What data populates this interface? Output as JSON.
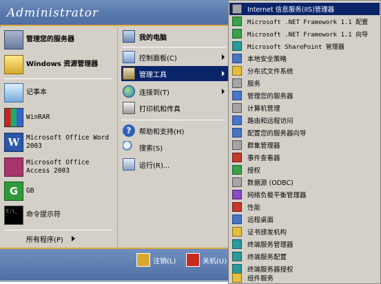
{
  "start_menu": {
    "user_name": "Administrator",
    "left_items": [
      {
        "label": "管理您的服务器",
        "icon": "server-manage-icon",
        "bold": true
      },
      {
        "label": "Windows 资源管理器",
        "icon": "explorer-icon",
        "bold": true
      },
      {
        "label": "记事本",
        "icon": "notepad-icon"
      },
      {
        "label": "WinRAR",
        "icon": "winrar-icon"
      },
      {
        "label": "Microsoft Office Word 2003",
        "icon": "word-icon"
      },
      {
        "label": "Microsoft Office Access 2003",
        "icon": "access-icon"
      },
      {
        "label": "GB",
        "icon": "gb-icon"
      },
      {
        "label": "命令提示符",
        "icon": "cmd-icon"
      }
    ],
    "all_programs": "所有程序(P)",
    "right_items": [
      {
        "label": "我的电脑",
        "icon": "computer-icon",
        "bold": true
      },
      {
        "label": "控制面板(C)",
        "icon": "control-panel-icon",
        "submenu": true
      },
      {
        "label": "管理工具",
        "icon": "admin-tools-icon",
        "submenu": true,
        "active": true
      },
      {
        "label": "连接到(T)",
        "icon": "connect-icon",
        "submenu": true
      },
      {
        "label": "打印机和传真",
        "icon": "printer-icon"
      },
      {
        "label": "帮助和支持(H)",
        "icon": "help-icon"
      },
      {
        "label": "搜索(S)",
        "icon": "search-icon"
      },
      {
        "label": "运行(R)...",
        "icon": "run-icon"
      }
    ],
    "footer": {
      "logoff": "注销(L)",
      "shutdown": "关机(U)"
    }
  },
  "submenu": {
    "items": [
      {
        "label": "Internet 信息服务(IIS)管理器",
        "icon": "iis-icon",
        "active": true
      },
      {
        "label": "Microsoft .NET Framework 1.1 配置",
        "icon": "dotnet-config-icon",
        "mono": true
      },
      {
        "label": "Microsoft .NET Framework 1.1 向导",
        "icon": "dotnet-wizard-icon",
        "mono": true
      },
      {
        "label": "Microsoft SharePoint 管理器",
        "icon": "sharepoint-icon",
        "mono": true
      },
      {
        "label": "本地安全策略",
        "icon": "security-policy-icon"
      },
      {
        "label": "分布式文件系统",
        "icon": "dfs-icon"
      },
      {
        "label": "服务",
        "icon": "services-icon"
      },
      {
        "label": "管理您的服务器",
        "icon": "manage-server-icon"
      },
      {
        "label": "计算机管理",
        "icon": "computer-management-icon"
      },
      {
        "label": "路由和远程访问",
        "icon": "routing-icon"
      },
      {
        "label": "配置您的服务器向导",
        "icon": "configure-server-icon"
      },
      {
        "label": "群集管理器",
        "icon": "cluster-icon"
      },
      {
        "label": "事件查看器",
        "icon": "event-viewer-icon"
      },
      {
        "label": "授权",
        "icon": "licensing-icon"
      },
      {
        "label": "数据源 (ODBC)",
        "icon": "odbc-icon"
      },
      {
        "label": "网络负载平衡管理器",
        "icon": "nlb-icon"
      },
      {
        "label": "性能",
        "icon": "performance-icon"
      },
      {
        "label": "远程桌面",
        "icon": "remote-desktop-icon"
      },
      {
        "label": "证书颁发机构",
        "icon": "certificate-icon"
      },
      {
        "label": "终端服务管理器",
        "icon": "ts-manager-icon"
      },
      {
        "label": "终端服务配置",
        "icon": "ts-config-icon"
      },
      {
        "label": "终端服务器授权",
        "icon": "ts-licensing-icon"
      },
      {
        "label": "组件服务",
        "icon": "component-services-icon"
      }
    ]
  }
}
